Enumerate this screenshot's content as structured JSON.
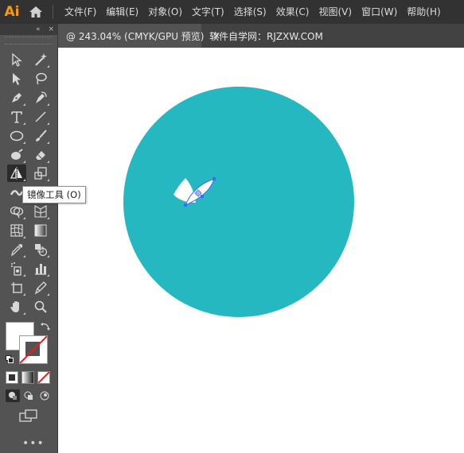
{
  "app": {
    "logo": "Ai",
    "brand_color": "#ff9a00"
  },
  "menu": [
    "文件(F)",
    "编辑(E)",
    "对象(O)",
    "文字(T)",
    "选择(S)",
    "效果(C)",
    "视图(V)",
    "窗口(W)",
    "帮助(H)"
  ],
  "tabs": [
    {
      "label": "@ 243.04% (CMYK/GPU 预览)",
      "close": "×"
    },
    {
      "label": "软件自学网：RJZXW.COM"
    }
  ],
  "toolbar": {
    "collapse": "«",
    "close": "×",
    "tooltip": "镜像工具 (O)",
    "more": "•••",
    "fill_color": "#ffffff",
    "stroke_color": "none"
  },
  "canvas": {
    "circle_color": "#26b8c1",
    "leaf_color": "#ffffff",
    "selection_color": "#3d6bff"
  }
}
